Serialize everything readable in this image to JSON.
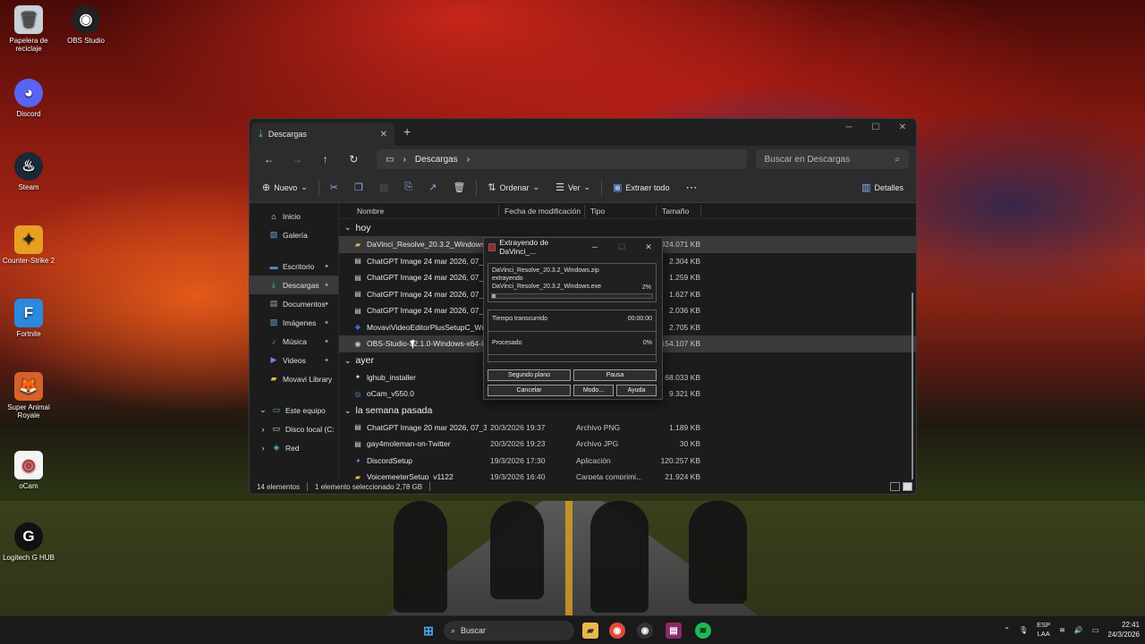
{
  "desktop_icons": [
    {
      "label": "Papelera de reciclaje",
      "icon": "recycle-bin-icon"
    },
    {
      "label": "OBS Studio",
      "icon": "obs-icon"
    },
    {
      "label": "Discord",
      "icon": "discord-icon"
    },
    {
      "label": "Steam",
      "icon": "steam-icon"
    },
    {
      "label": "Counter-Strike 2",
      "icon": "cs2-icon"
    },
    {
      "label": "Fortnite",
      "icon": "fortnite-icon"
    },
    {
      "label": "Super Animal Royale",
      "icon": "super-animal-royale-icon"
    },
    {
      "label": "oCam",
      "icon": "ocam-icon"
    },
    {
      "label": "Logitech G HUB",
      "icon": "logitech-icon"
    }
  ],
  "explorer": {
    "tab_title": "Descargas",
    "address": "Descargas",
    "search_placeholder": "Buscar en Descargas",
    "toolbar": {
      "new": "Nuevo",
      "sort": "Ordenar",
      "view": "Ver",
      "extract_all": "Extraer todo",
      "details": "Detalles"
    },
    "sidebar": [
      {
        "label": "Inicio",
        "icon": "home-icon"
      },
      {
        "label": "Galería",
        "icon": "gallery-icon"
      },
      {
        "label": "Escritorio",
        "icon": "desktop-icon",
        "pinned": true
      },
      {
        "label": "Descargas",
        "icon": "download-icon",
        "pinned": true
      },
      {
        "label": "Documentos",
        "icon": "documents-icon",
        "pinned": true
      },
      {
        "label": "Imágenes",
        "icon": "images-icon",
        "pinned": true
      },
      {
        "label": "Música",
        "icon": "music-icon",
        "pinned": true
      },
      {
        "label": "Videos",
        "icon": "videos-icon",
        "pinned": true
      },
      {
        "label": "Movavi Library",
        "icon": "folder-icon"
      },
      {
        "label": "Este equipo",
        "icon": "pc-icon"
      },
      {
        "label": "Disco local (C:",
        "icon": "drive-icon"
      },
      {
        "label": "Red",
        "icon": "network-icon"
      }
    ],
    "columns": [
      "Nombre",
      "Fecha de modificación",
      "Tipo",
      "Tamaño"
    ],
    "groups": [
      {
        "label": "hoy",
        "rows": [
          {
            "name": "DaVinci_Resolve_20.3.2_Windows",
            "date": "",
            "type": "",
            "size": "2.924.071 KB",
            "icon": "zip-folder-icon",
            "selected": true
          },
          {
            "name": "ChatGPT Image 24 mar 2026, 07_47_0",
            "date": "",
            "type": "",
            "size": "2.304 KB",
            "icon": "image-file-icon"
          },
          {
            "name": "ChatGPT Image 24 mar 2026, 07_41_1",
            "date": "",
            "type": "",
            "size": "1.259 KB",
            "icon": "image-file-icon"
          },
          {
            "name": "ChatGPT Image 24 mar 2026, 07_41_0",
            "date": "",
            "type": "",
            "size": "1.627 KB",
            "icon": "image-file-icon"
          },
          {
            "name": "ChatGPT Image 24 mar 2026, 07_37_4",
            "date": "",
            "type": "",
            "size": "2.036 KB",
            "icon": "image-file-icon"
          },
          {
            "name": "MovaviVideoEditorPlusSetupC_Wnjw",
            "date": "",
            "type": "",
            "size": "2.705 KB",
            "icon": "movavi-icon"
          },
          {
            "name": "OBS-Studio-32.1.0-Windows-x64-Inst",
            "date": "",
            "type": "",
            "size": "154.107 KB",
            "icon": "obs-icon",
            "hover": true
          }
        ]
      },
      {
        "label": "ayer",
        "rows": [
          {
            "name": "lghub_installer",
            "date": "",
            "type": "",
            "size": "68.033 KB",
            "icon": "logitech-icon"
          },
          {
            "name": "oCam_v550.0",
            "date": "",
            "type": "",
            "size": "9.321 KB",
            "icon": "ocam-icon"
          }
        ]
      },
      {
        "label": "la semana pasada",
        "rows": [
          {
            "name": "ChatGPT Image 20 mar 2026, 07_37_59 p...",
            "date": "20/3/2026 19:37",
            "type": "Archivo PNG",
            "size": "1.189 KB",
            "icon": "image-file-icon"
          },
          {
            "name": "gay4moleman-on-Twitter",
            "date": "20/3/2026 19:23",
            "type": "Archivo JPG",
            "size": "30 KB",
            "icon": "image-file-icon"
          },
          {
            "name": "DiscordSetup",
            "date": "19/3/2026 17:30",
            "type": "Aplicación",
            "size": "120.257 KB",
            "icon": "discord-icon"
          },
          {
            "name": "VoicemeeterSetup_v1122",
            "date": "19/3/2026 16:40",
            "type": "Carpeta comprimi...",
            "size": "21.924 KB",
            "icon": "zip-folder-icon"
          }
        ]
      }
    ],
    "status": {
      "count": "14 elementos",
      "selection": "1 elemento seleccionado 2,78 GB"
    }
  },
  "extract_dialog": {
    "title": "Extrayendo de DaVinci_...",
    "archive": "DaVinci_Resolve_20.3.2_Windows.zip",
    "action": "extrayendo",
    "file": "DaVinci_Resolve_20.3.2_Windows.exe",
    "file_percent": "2%",
    "progress": 0.02,
    "elapsed_label": "Tiempo transcurrido",
    "elapsed_value": "00:00:00",
    "processed_label": "Procesado",
    "processed_value": "0%",
    "buttons": {
      "background": "Segundo plano",
      "pause": "Pausa",
      "cancel": "Cancelar",
      "mode": "Modo...",
      "help": "Ayuda"
    }
  },
  "taskbar": {
    "search": "Buscar",
    "language": "ESP",
    "layout": "LAA",
    "time": "22:41",
    "date": "24/3/2026"
  },
  "colors": {
    "accent": "#4cc2a0",
    "folder": "#e8b84a",
    "selected_row": "#3a3a3a"
  }
}
